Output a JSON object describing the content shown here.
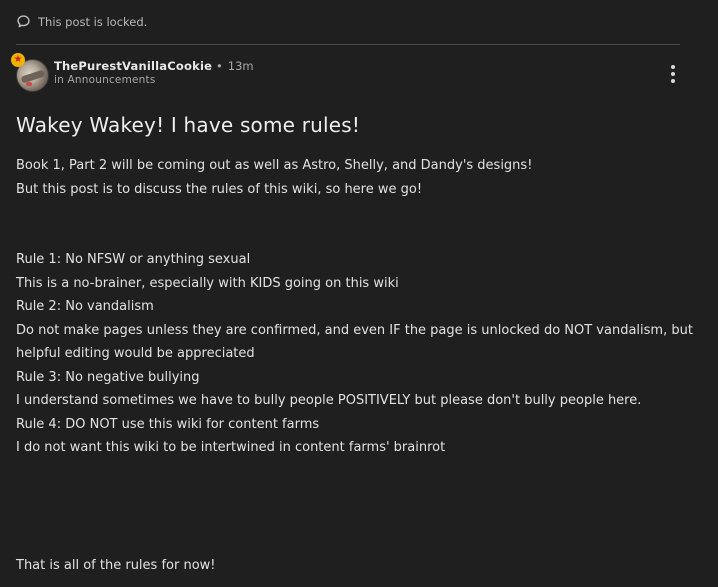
{
  "locked_notice": "This post is locked.",
  "author": {
    "name": "ThePurestVanillaCookie",
    "separator": "•",
    "time_ago": "13m",
    "category_prefix": "in",
    "category": "Announcements"
  },
  "post": {
    "title": "Wakey Wakey! I have some rules!",
    "intro": [
      "Book 1, Part 2 will be coming out as well as Astro, Shelly, and Dandy's designs!",
      "But this post is to discuss the rules of this wiki, so here we go!"
    ],
    "rules": [
      "Rule 1: No NFSW or anything sexual",
      "This is a no-brainer, especially with KIDS going on this wiki",
      "Rule 2: No vandalism",
      "Do not make pages unless they are confirmed, and even IF the page is unlocked do NOT vandalism, but helpful editing would be appreciated",
      "Rule 3: No negative bullying",
      "I understand sometimes we have to bully people POSITIVELY but please don't bully people here.",
      "Rule 4: DO NOT use this wiki for content farms",
      "I do not want this wiki to be intertwined in content farms' brainrot"
    ],
    "closing": "That is all of the rules for now!"
  },
  "icons": {
    "locked": "comment-bubble-icon",
    "badge": "star-badge-icon",
    "more": "more-vertical-icon"
  },
  "colors": {
    "background": "#1f1f1f",
    "text": "#e2e2e2",
    "muted": "#a8a8a8",
    "badge": "#f0b400"
  }
}
